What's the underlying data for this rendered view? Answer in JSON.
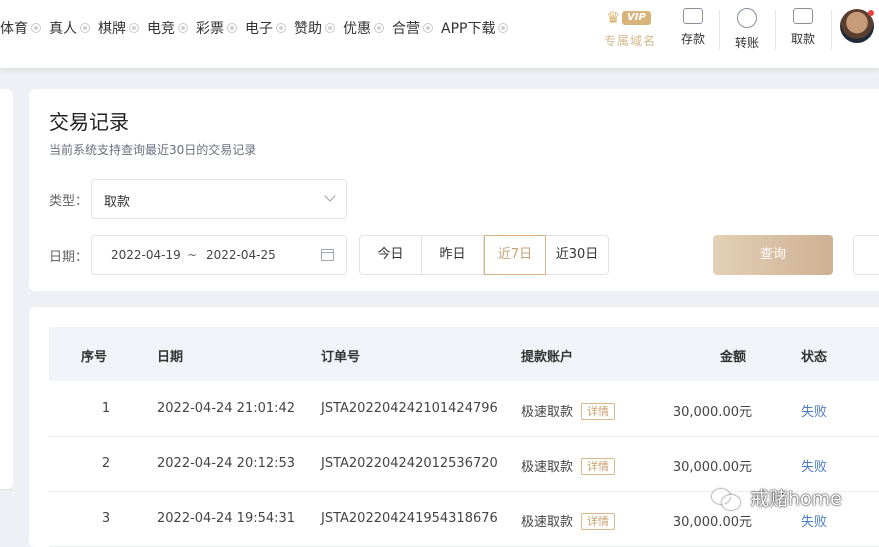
{
  "nav": {
    "items": [
      {
        "label": "体育"
      },
      {
        "label": "真人"
      },
      {
        "label": "棋牌"
      },
      {
        "label": "电竞"
      },
      {
        "label": "彩票"
      },
      {
        "label": "电子"
      },
      {
        "label": "赞助"
      },
      {
        "label": "优惠"
      },
      {
        "label": "合营"
      },
      {
        "label": "APP下载"
      }
    ]
  },
  "header": {
    "vip_badge": "VIP",
    "vip_label": "专属域名",
    "deposit_label": "存款",
    "transfer_label": "转账",
    "withdraw_label": "取款"
  },
  "filter": {
    "title": "交易记录",
    "subtitle": "当前系统支持查询最近30日的交易记录",
    "type_label": "类型：",
    "type_value": "取款",
    "date_label": "日期：",
    "date_start": "2022-04-19",
    "date_sep": "~",
    "date_end": "2022-04-25",
    "quick": [
      "今日",
      "昨日",
      "近7日",
      "近30日"
    ],
    "active_quick": "近7日",
    "query_label": "查询"
  },
  "table": {
    "headers": {
      "index": "序号",
      "date": "日期",
      "order": "订单号",
      "account": "提款账户",
      "amount": "金额",
      "status": "状态"
    },
    "rows": [
      {
        "index": "1",
        "date": "2022-04-24 21:01:42",
        "order": "JSTA202204242101424796",
        "account": "极速取款",
        "detail": "详情",
        "amount": "30,000.00元",
        "status": "失败"
      },
      {
        "index": "2",
        "date": "2022-04-24 20:12:53",
        "order": "JSTA202204242012536720",
        "account": "极速取款",
        "detail": "详情",
        "amount": "30,000.00元",
        "status": "失败"
      },
      {
        "index": "3",
        "date": "2022-04-24 19:54:31",
        "order": "JSTA202204241954318676",
        "account": "极速取款",
        "detail": "详情",
        "amount": "30,000.00元",
        "status": "失败"
      }
    ]
  },
  "watermark": {
    "text": "戒赌home"
  },
  "colors": {
    "accent_gold": "#c9a06a",
    "button_gradient_start": "#e3d0b6",
    "button_gradient_end": "#cfb193",
    "status_fail": "#4a7dc9",
    "page_bg": "#eef0f5"
  }
}
